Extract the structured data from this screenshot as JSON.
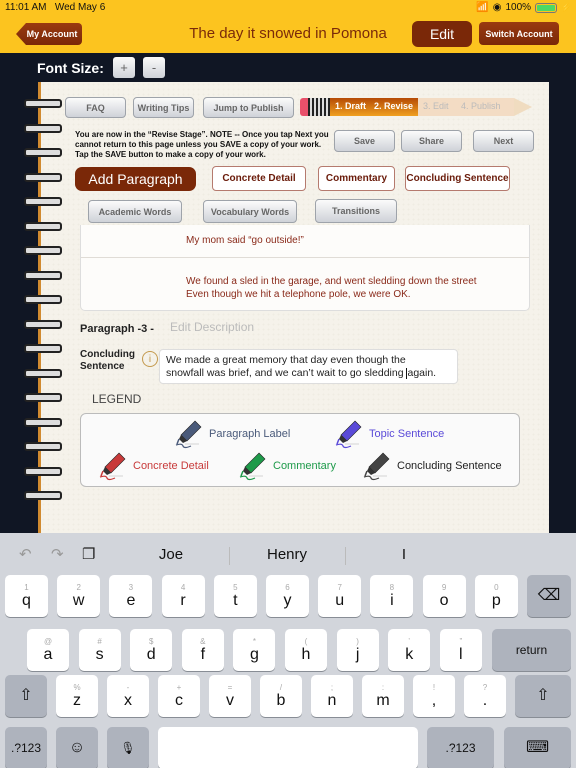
{
  "status_bar": {
    "time": "11:01 AM",
    "date": "Wed May 6",
    "battery": "100%",
    "icons": [
      "wifi-icon",
      "location-icon",
      "battery-icon",
      "charging-icon"
    ]
  },
  "header": {
    "back_label": "My Account",
    "title": "The day it snowed in Pomona",
    "edit_label": "Edit",
    "switch_label": "Switch Account"
  },
  "font_size": {
    "label": "Font Size:",
    "increase": "+",
    "decrease": "-"
  },
  "toolbar": {
    "faq": "FAQ",
    "writing_tips": "Writing Tips",
    "jump_to_publish": "Jump to Publish",
    "save": "Save",
    "share": "Share",
    "next": "Next"
  },
  "progress": {
    "stages": [
      {
        "label": "1. Draft",
        "complete": true
      },
      {
        "label": "2. Revise",
        "complete": true
      },
      {
        "label": "3. Edit",
        "complete": false
      },
      {
        "label": "4. Publish",
        "complete": false
      }
    ],
    "current_stage": 2,
    "total_stages": 4
  },
  "notice": "You are now in the “Revise Stage”.  NOTE -- Once you tap Next you cannot return to this page unless you SAVE a copy of your work. Tap the SAVE button to make a copy of your work.",
  "actions": {
    "add_paragraph": "Add Paragraph",
    "concrete_detail": "Concrete Detail",
    "commentary": "Commentary",
    "concluding_sentence": "Concluding Sentence",
    "academic_words": "Academic Words",
    "vocabulary_words": "Vocabulary Words",
    "transitions": "Transitions"
  },
  "paragraph_lines": [
    "My mom said “go outside!”",
    "We found a sled in the garage, and went sledding down the street",
    "Even though we hit a telephone pole, we were OK."
  ],
  "paragraph": {
    "label": "Paragraph -3  -",
    "description_placeholder": "Edit Description",
    "concluding_label_1": "Concluding",
    "concluding_label_2": "Sentence",
    "info_icon": "i",
    "concluding_text_1": "We made a great memory that day even though the",
    "concluding_text_2a": "snowfall was brief, and we can’t wait to go sledding",
    "concluding_text_2b": "again."
  },
  "legend": {
    "title": "LEGEND",
    "items": [
      {
        "label": "Paragraph Label",
        "color": "#4a5a7a"
      },
      {
        "label": "Topic Sentence",
        "color": "#5a4ad8"
      },
      {
        "label": "Concrete Detail",
        "color": "#c83a3a"
      },
      {
        "label": "Commentary",
        "color": "#1e9a4a"
      },
      {
        "label": "Concluding Sentence",
        "color": "#444444"
      }
    ]
  },
  "keyboard": {
    "suggestions": [
      "Joe",
      "Henry",
      "I"
    ],
    "row1": [
      {
        "alt": "1",
        "key": "q"
      },
      {
        "alt": "2",
        "key": "w"
      },
      {
        "alt": "3",
        "key": "e"
      },
      {
        "alt": "4",
        "key": "r"
      },
      {
        "alt": "5",
        "key": "t"
      },
      {
        "alt": "6",
        "key": "y"
      },
      {
        "alt": "7",
        "key": "u"
      },
      {
        "alt": "8",
        "key": "i"
      },
      {
        "alt": "9",
        "key": "o"
      },
      {
        "alt": "0",
        "key": "p"
      }
    ],
    "row2": [
      {
        "alt": "@",
        "key": "a"
      },
      {
        "alt": "#",
        "key": "s"
      },
      {
        "alt": "$",
        "key": "d"
      },
      {
        "alt": "&",
        "key": "f"
      },
      {
        "alt": "*",
        "key": "g"
      },
      {
        "alt": "(",
        "key": "h"
      },
      {
        "alt": ")",
        "key": "j"
      },
      {
        "alt": "’",
        "key": "k"
      },
      {
        "alt": "”",
        "key": "l"
      }
    ],
    "row3": [
      {
        "alt": "%",
        "key": "z"
      },
      {
        "alt": "-",
        "key": "x"
      },
      {
        "alt": "+",
        "key": "c"
      },
      {
        "alt": "=",
        "key": "v"
      },
      {
        "alt": "/",
        "key": "b"
      },
      {
        "alt": ";",
        "key": "n"
      },
      {
        "alt": ":",
        "key": "m"
      },
      {
        "alt": "!",
        "key": ","
      },
      {
        "alt": "?",
        "key": "."
      }
    ],
    "return": "return",
    "numbers": ".?123",
    "backspace": "⌫",
    "shift": "⇧",
    "emoji": "☺",
    "mic": "🎙",
    "hide": "⌨",
    "undo": "↶",
    "redo": "↷",
    "paste": "❐"
  },
  "colors": {
    "header_bg": "#fcc41f",
    "brand_brown": "#7a2808",
    "paragraph_text": "#8a2a1a",
    "background_dark": "#101624"
  }
}
